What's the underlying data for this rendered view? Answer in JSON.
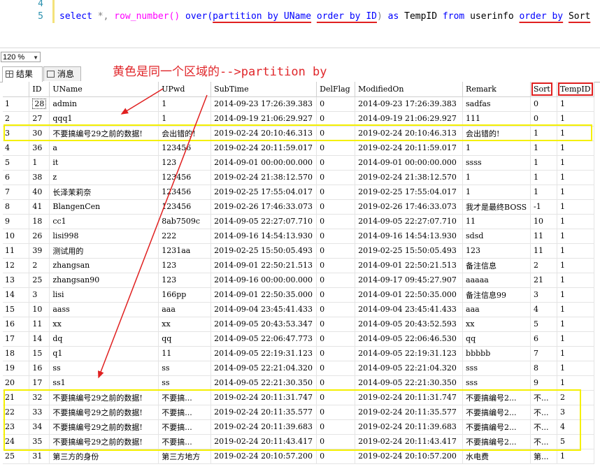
{
  "editor": {
    "lines": [
      {
        "num": "4",
        "code": ""
      },
      {
        "num": "5",
        "code": "select *, row_number() over(partition by UName order by ID) as TempID from userinfo order by Sort"
      }
    ],
    "tokens": [
      "select",
      "*,",
      "row_number()",
      "over(",
      "partition by UName",
      "order by ID",
      ")",
      "as",
      "TempID",
      "from",
      "userinfo",
      "order by",
      "Sort"
    ]
  },
  "zoom": {
    "value": "120 %"
  },
  "tabs": [
    {
      "label": "结果"
    },
    {
      "label": "消息"
    }
  ],
  "annotation": "黄色是同一个区域的-->partition by",
  "grid": {
    "columns": [
      "",
      "ID",
      "UName",
      "UPwd",
      "SubTime",
      "DelFlag",
      "ModifiedOn",
      "Remark",
      "Sort",
      "TempID"
    ],
    "rows": [
      [
        "1",
        "28",
        "admin",
        "1",
        "2014-09-23 17:26:39.383",
        "0",
        "2014-09-23 17:26:39.383",
        "sadfas",
        "0",
        "1"
      ],
      [
        "2",
        "27",
        "qqq1",
        "1",
        "2014-09-19 21:06:29.927",
        "0",
        "2014-09-19 21:06:29.927",
        "111",
        "0",
        "1"
      ],
      [
        "3",
        "30",
        "不要搞编号29之前的数据!",
        "会出错的!",
        "2019-02-24 20:10:46.313",
        "0",
        "2019-02-24 20:10:46.313",
        "会出错的!",
        "1",
        "1"
      ],
      [
        "4",
        "36",
        "a",
        "123456",
        "2019-02-24 20:11:59.017",
        "0",
        "2019-02-24 20:11:59.017",
        "1",
        "1",
        "1"
      ],
      [
        "5",
        "1",
        "it",
        "123",
        "2014-09-01 00:00:00.000",
        "0",
        "2014-09-01 00:00:00.000",
        "ssss",
        "1",
        "1"
      ],
      [
        "6",
        "38",
        "z",
        "123456",
        "2019-02-24 21:38:12.570",
        "0",
        "2019-02-24 21:38:12.570",
        "1",
        "1",
        "1"
      ],
      [
        "7",
        "40",
        "长泽茉莉奈",
        "123456",
        "2019-02-25 17:55:04.017",
        "0",
        "2019-02-25 17:55:04.017",
        "1",
        "1",
        "1"
      ],
      [
        "8",
        "41",
        "BlangenCen",
        "123456",
        "2019-02-26 17:46:33.073",
        "0",
        "2019-02-26 17:46:33.073",
        "我才是最终BOSS",
        "-1",
        "1"
      ],
      [
        "9",
        "18",
        "cc1",
        "8ab7509c",
        "2014-09-05 22:27:07.710",
        "0",
        "2014-09-05 22:27:07.710",
        "11",
        "10",
        "1"
      ],
      [
        "10",
        "26",
        "lisi998",
        "222",
        "2014-09-16 14:54:13.930",
        "0",
        "2014-09-16 14:54:13.930",
        "sdsd",
        "11",
        "1"
      ],
      [
        "11",
        "39",
        "测试用的",
        "1231aa",
        "2019-02-25 15:50:05.493",
        "0",
        "2019-02-25 15:50:05.493",
        "123",
        "11",
        "1"
      ],
      [
        "12",
        "2",
        "zhangsan",
        "123",
        "2014-09-01 22:50:21.513",
        "0",
        "2014-09-01 22:50:21.513",
        "备注信息",
        "2",
        "1"
      ],
      [
        "13",
        "25",
        "zhangsan90",
        "123",
        "2014-09-16 00:00:00.000",
        "0",
        "2014-09-17 09:45:27.907",
        "aaaaa",
        "21",
        "1"
      ],
      [
        "14",
        "3",
        "lisi",
        "166pp",
        "2014-09-01 22:50:35.000",
        "0",
        "2014-09-01 22:50:35.000",
        "备注信息99",
        "3",
        "1"
      ],
      [
        "15",
        "10",
        "aass",
        "aaa",
        "2014-09-04 23:45:41.433",
        "0",
        "2014-09-04 23:45:41.433",
        "aaa",
        "4",
        "1"
      ],
      [
        "16",
        "11",
        "xx",
        "xx",
        "2014-09-05 20:43:53.347",
        "0",
        "2014-09-05 20:43:52.593",
        "xx",
        "5",
        "1"
      ],
      [
        "17",
        "14",
        "dq",
        "qq",
        "2014-09-05 22:06:47.773",
        "0",
        "2014-09-05 22:06:46.530",
        "qq",
        "6",
        "1"
      ],
      [
        "18",
        "15",
        "q1",
        "11",
        "2014-09-05 22:19:31.123",
        "0",
        "2014-09-05 22:19:31.123",
        "bbbbb",
        "7",
        "1"
      ],
      [
        "19",
        "16",
        "ss",
        "ss",
        "2014-09-05 22:21:04.320",
        "0",
        "2014-09-05 22:21:04.320",
        "sss",
        "8",
        "1"
      ],
      [
        "20",
        "17",
        "ss1",
        "ss",
        "2014-09-05 22:21:30.350",
        "0",
        "2014-09-05 22:21:30.350",
        "sss",
        "9",
        "1"
      ],
      [
        "21",
        "32",
        "不要搞编号29之前的数据!",
        "不要搞...",
        "2019-02-24 20:11:31.747",
        "0",
        "2019-02-24 20:11:31.747",
        "不要搞编号2...",
        "不...",
        "2"
      ],
      [
        "22",
        "33",
        "不要搞编号29之前的数据!",
        "不要搞...",
        "2019-02-24 20:11:35.577",
        "0",
        "2019-02-24 20:11:35.577",
        "不要搞编号2...",
        "不...",
        "3"
      ],
      [
        "23",
        "34",
        "不要搞编号29之前的数据!",
        "不要搞...",
        "2019-02-24 20:11:39.683",
        "0",
        "2019-02-24 20:11:39.683",
        "不要搞编号2...",
        "不...",
        "4"
      ],
      [
        "24",
        "35",
        "不要搞编号29之前的数据!",
        "不要搞...",
        "2019-02-24 20:11:43.417",
        "0",
        "2019-02-24 20:11:43.417",
        "不要搞编号2...",
        "不...",
        "5"
      ],
      [
        "25",
        "31",
        "第三方的身份",
        "第三方地方",
        "2019-02-24 20:10:57.200",
        "0",
        "2019-02-24 20:10:57.200",
        "水电费",
        "第...",
        "1"
      ]
    ]
  },
  "colors": {
    "annotation": "#e0262a",
    "highlight": "#f5f000",
    "keyword": "#0000ff",
    "function": "#ff00ff",
    "line_number": "#2b91af"
  }
}
